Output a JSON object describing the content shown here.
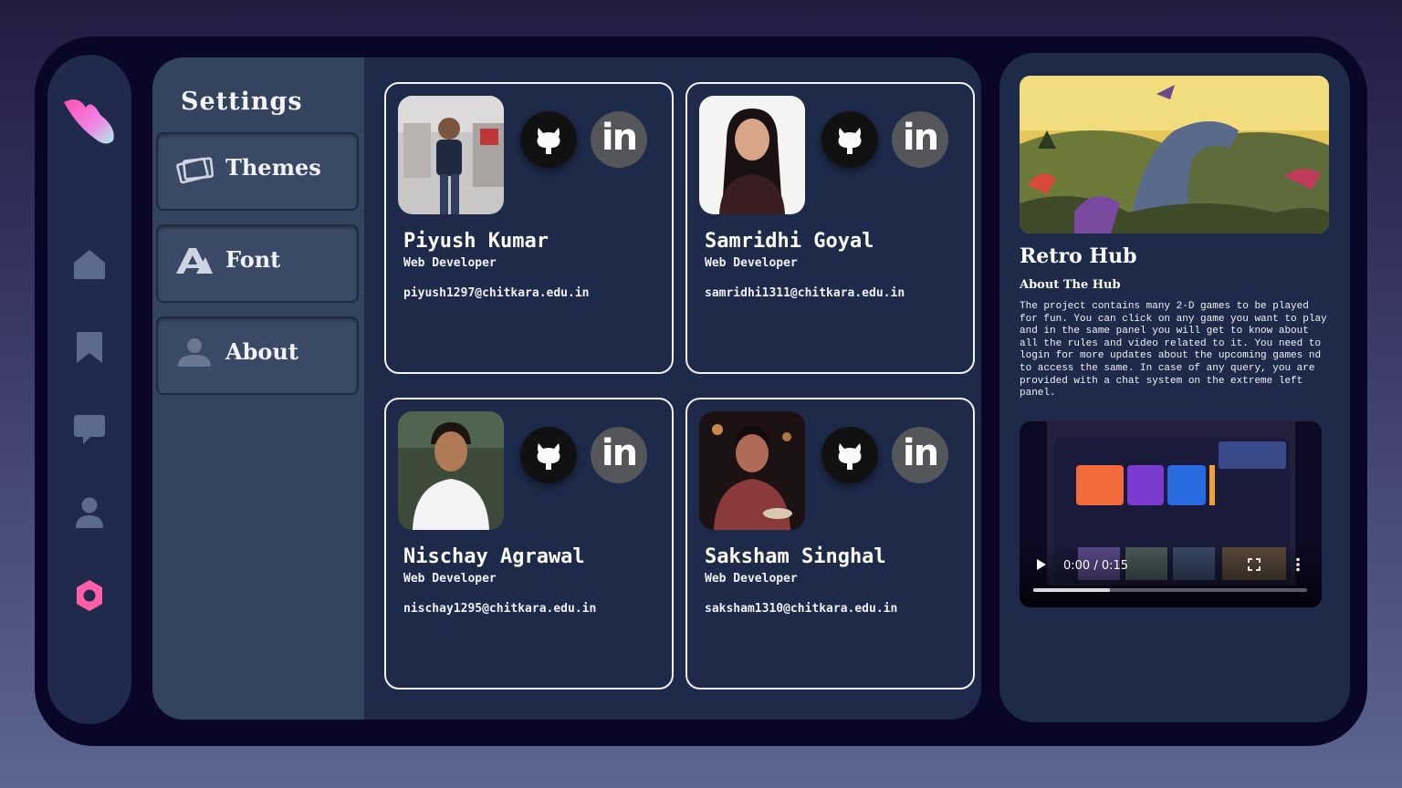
{
  "colors": {
    "accent": "#ff5fa8",
    "rail": "#1f2a4c",
    "panel": "#34435e",
    "main": "#1d2a4a",
    "icon": "#5c6b8c"
  },
  "rail": {
    "items": [
      {
        "name": "home",
        "icon": "home-icon"
      },
      {
        "name": "bookmarks",
        "icon": "bookmark-icon"
      },
      {
        "name": "chat",
        "icon": "chat-icon"
      },
      {
        "name": "profile",
        "icon": "user-icon"
      },
      {
        "name": "settings",
        "icon": "gear-icon",
        "active": true
      }
    ]
  },
  "settings": {
    "title": "Settings",
    "menu": [
      {
        "label": "Themes",
        "icon": "cards-icon"
      },
      {
        "label": "Font",
        "icon": "font-icon"
      },
      {
        "label": "About",
        "icon": "user-icon"
      }
    ]
  },
  "team": [
    {
      "name": "Piyush Kumar",
      "role": "Web Developer",
      "email": "piyush1297@chitkara.edu.in",
      "github_icon": "github-icon",
      "linkedin_label": "in"
    },
    {
      "name": "Samridhi Goyal",
      "role": "Web Developer",
      "email": "samridhi1311@chitkara.edu.in",
      "github_icon": "github-icon",
      "linkedin_label": "in"
    },
    {
      "name": "Nischay Agrawal",
      "role": "Web Developer",
      "email": "nischay1295@chitkara.edu.in",
      "github_icon": "github-icon",
      "linkedin_label": "in"
    },
    {
      "name": "Saksham Singhal",
      "role": "Web Developer",
      "email": "saksham1310@chitkara.edu.in",
      "github_icon": "github-icon",
      "linkedin_label": "in"
    }
  ],
  "hub": {
    "title": "Retro Hub",
    "subtitle": "About The Hub",
    "description": "The project contains many 2-D games to be played for fun. You can click on any game you want to play and in the same panel you will get to know about all the rules and video related to it. You need to login for more updates about the upcoming games nd to access the same. In case of any query, you are provided with a chat system on the extreme left panel.",
    "video": {
      "time": "0:00 / 0:15",
      "progress": 0.28
    }
  }
}
